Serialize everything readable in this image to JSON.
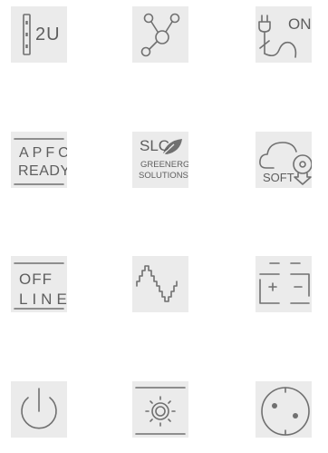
{
  "icons": [
    {
      "id": "rack-2u-icon",
      "text": "2U"
    },
    {
      "id": "network-topology-icon"
    },
    {
      "id": "plug-on-icon",
      "text": "ON"
    },
    {
      "id": "apfc-ready-icon",
      "line1": "APFC",
      "line2": "READY"
    },
    {
      "id": "slc-greenergy-logo",
      "brand": "SLC",
      "line1": "GREENERGY",
      "line2": "SOLUTIONS"
    },
    {
      "id": "cloud-soft-icon",
      "text": "SOFT"
    },
    {
      "id": "offline-icon",
      "line1": "OFF",
      "line2": "LINE"
    },
    {
      "id": "sine-wave-icon"
    },
    {
      "id": "battery-icon",
      "plus": "+",
      "minus": "−"
    },
    {
      "id": "power-icon"
    },
    {
      "id": "brightness-icon"
    },
    {
      "id": "socket-icon"
    }
  ],
  "colors": {
    "tile_bg": "#ebebeb",
    "stroke": "#707070",
    "text": "#5e5e5e",
    "page_bg": "#ffffff"
  }
}
